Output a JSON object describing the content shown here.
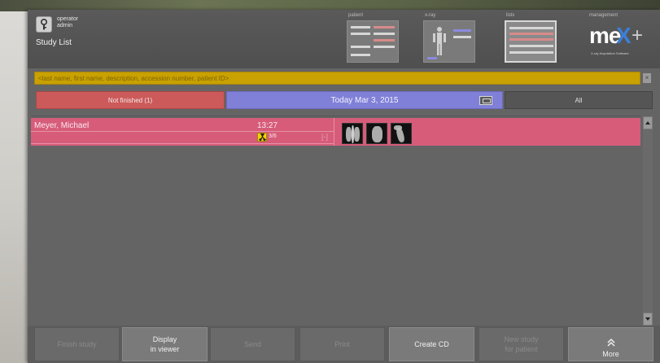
{
  "header": {
    "user_role": "operator",
    "user_name": "admin",
    "page_title": "Study List",
    "nav_tabs": [
      {
        "label": "patient"
      },
      {
        "label": "x-ray"
      },
      {
        "label": "lists"
      },
      {
        "label": "management"
      }
    ],
    "logo": {
      "text_me": "me",
      "text_x": "X",
      "text_plus": "+",
      "tagline": "X-ray Acquisition Software"
    }
  },
  "search": {
    "placeholder": "<last name, first name, description, accession number, patient ID>",
    "value": "",
    "clear_label": "×"
  },
  "filters": {
    "not_finished": "Not finished (1)",
    "today": "Today Mar 3, 2015",
    "all": "All"
  },
  "studies": [
    {
      "name": "Meyer, Michael",
      "time": "13:27",
      "image_count": "3/6",
      "bracket": "[-]"
    }
  ],
  "toolbar": {
    "finish_study": "Finish study",
    "display_line1": "Display",
    "display_line2": "in viewer",
    "send": "Send",
    "print": "Print",
    "create_cd": "Create CD",
    "new_study_line1": "New study",
    "new_study_line2": "for patient",
    "more": "More"
  },
  "colors": {
    "row": "#d65c7a",
    "search": "#c9a100",
    "not_finished": "#cc5a5a",
    "today": "#8080d8",
    "logo_x": "#3b7fd9"
  },
  "icons": [
    "key-icon",
    "calendar-icon",
    "radiation-icon",
    "chevron-up-icon",
    "scroll-up-icon",
    "scroll-down-icon"
  ]
}
